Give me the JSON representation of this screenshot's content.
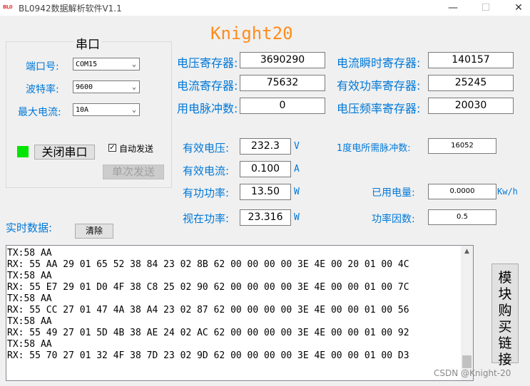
{
  "window": {
    "title": "BL0942数据解析软件V1.1",
    "icon_text": "BL0",
    "min_glyph": "—",
    "max_glyph": "☐",
    "close_glyph": "✕"
  },
  "serial": {
    "group_title": "串口",
    "port_label": "端口号:",
    "port_value": "COM15",
    "baud_label": "波特率:",
    "baud_value": "9600",
    "max_current_label": "最大电流:",
    "max_current_value": "10A",
    "status_color": "#00e600",
    "close_port_label": "关闭串口",
    "auto_send_label": "自动发送",
    "auto_send_checked": true,
    "single_send_label": "单次发送"
  },
  "header_title": "Knight20",
  "registers": {
    "voltage_reg_label": "电压寄存器:",
    "voltage_reg_value": "3690290",
    "current_reg_label": "电流寄存器:",
    "current_reg_value": "75632",
    "pulse_label": "用电脉冲数:",
    "pulse_value": "0",
    "instant_current_reg_label": "电流瞬时寄存器:",
    "instant_current_reg_value": "140157",
    "active_power_reg_label": "有效功率寄存器:",
    "active_power_reg_value": "25245",
    "voltage_freq_reg_label": "电压频率寄存器:",
    "voltage_freq_reg_value": "20030"
  },
  "measurements": {
    "rms_voltage_label": "有效电压:",
    "rms_voltage_value": "232.3",
    "rms_voltage_unit": "V",
    "rms_current_label": "有效电流:",
    "rms_current_value": "0.100",
    "rms_current_unit": "A",
    "active_power_label": "有功功率:",
    "active_power_value": "13.50",
    "active_power_unit": "W",
    "apparent_power_label": "视在功率:",
    "apparent_power_value": "23.316",
    "apparent_power_unit": "W",
    "pulses_per_kwh_label": "1度电所需脉冲数:",
    "pulses_per_kwh_value": "16052",
    "used_energy_label": "已用电量:",
    "used_energy_value": "0.0000",
    "used_energy_unit": "Kw/h",
    "power_factor_label": "功率因数:",
    "power_factor_value": "0.5"
  },
  "realtime": {
    "label": "实时数据:",
    "clear_label": "清除",
    "log": "TX:58 AA\nRX: 55 AA 29 01 65 52 38 84 23 02 8B 62 00 00 00 00 3E 4E 00 20 01 00 4C\nTX:58 AA\nRX: 55 E7 29 01 D0 4F 38 C8 25 02 90 62 00 00 00 00 3E 4E 00 00 01 00 7C\nTX:58 AA\nRX: 55 CC 27 01 47 4A 38 A4 23 02 87 62 00 00 00 00 3E 4E 00 00 01 00 56\nTX:58 AA\nRX: 55 49 27 01 5D 4B 38 AE 24 02 AC 62 00 00 00 00 3E 4E 00 00 01 00 92\nTX:58 AA\nRX: 55 70 27 01 32 4F 38 7D 23 02 9D 62 00 00 00 00 3E 4E 00 00 01 00 D3"
  },
  "buy_button_label": "模块购买链接",
  "watermark": "CSDN @Knight-20"
}
